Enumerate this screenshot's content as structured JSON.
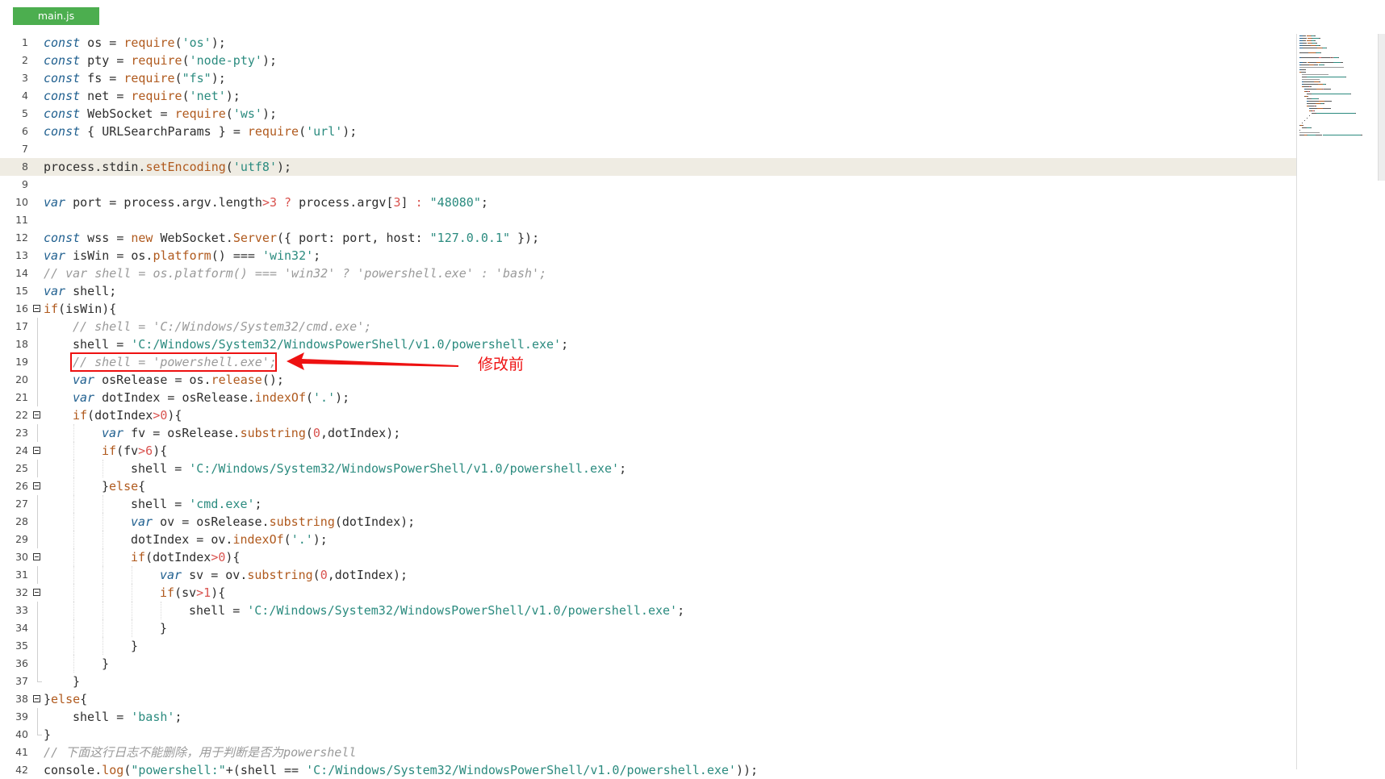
{
  "tab": {
    "label": "main.js"
  },
  "colors": {
    "tab_bg": "#4cae4f",
    "highlight_line": "#efece3",
    "keyword": "#1f5f8f",
    "string": "#2b8b7f",
    "function": "#b05a1e",
    "number": "#d9534f",
    "comment": "#9a9a9a",
    "annotation": "#ee1111"
  },
  "annotation": {
    "label": "修改前",
    "target_line": 19
  },
  "highlighted_line": 8,
  "code": [
    {
      "n": "1",
      "indent": 0,
      "tokens": [
        [
          "k",
          "const"
        ],
        [
          "o",
          " os "
        ],
        [
          "o",
          "="
        ],
        [
          "o",
          " "
        ],
        [
          "f",
          "require"
        ],
        [
          "o",
          "("
        ],
        [
          "s",
          "'os'"
        ],
        [
          "o",
          ");"
        ]
      ]
    },
    {
      "n": "2",
      "indent": 0,
      "tokens": [
        [
          "k",
          "const"
        ],
        [
          "o",
          " pty "
        ],
        [
          "o",
          "="
        ],
        [
          "o",
          " "
        ],
        [
          "f",
          "require"
        ],
        [
          "o",
          "("
        ],
        [
          "s",
          "'node-pty'"
        ],
        [
          "o",
          ");"
        ]
      ]
    },
    {
      "n": "3",
      "indent": 0,
      "tokens": [
        [
          "k",
          "const"
        ],
        [
          "o",
          " fs "
        ],
        [
          "o",
          "="
        ],
        [
          "o",
          " "
        ],
        [
          "f",
          "require"
        ],
        [
          "o",
          "("
        ],
        [
          "s",
          "\"fs\""
        ],
        [
          "o",
          ");"
        ]
      ]
    },
    {
      "n": "4",
      "indent": 0,
      "tokens": [
        [
          "k",
          "const"
        ],
        [
          "o",
          " net "
        ],
        [
          "o",
          "="
        ],
        [
          "o",
          " "
        ],
        [
          "f",
          "require"
        ],
        [
          "o",
          "("
        ],
        [
          "s",
          "'net'"
        ],
        [
          "o",
          ");"
        ]
      ]
    },
    {
      "n": "5",
      "indent": 0,
      "tokens": [
        [
          "k",
          "const"
        ],
        [
          "o",
          " WebSocket "
        ],
        [
          "o",
          "="
        ],
        [
          "o",
          " "
        ],
        [
          "f",
          "require"
        ],
        [
          "o",
          "("
        ],
        [
          "s",
          "'ws'"
        ],
        [
          "o",
          ");"
        ]
      ]
    },
    {
      "n": "6",
      "indent": 0,
      "tokens": [
        [
          "k",
          "const"
        ],
        [
          "o",
          " { URLSearchParams } "
        ],
        [
          "o",
          "="
        ],
        [
          "o",
          " "
        ],
        [
          "f",
          "require"
        ],
        [
          "o",
          "("
        ],
        [
          "s",
          "'url'"
        ],
        [
          "o",
          ");"
        ]
      ]
    },
    {
      "n": "7",
      "indent": 0,
      "tokens": []
    },
    {
      "n": "8",
      "indent": 0,
      "tokens": [
        [
          "o",
          "process.stdin."
        ],
        [
          "f",
          "setEncoding"
        ],
        [
          "o",
          "("
        ],
        [
          "s",
          "'utf8'"
        ],
        [
          "o",
          ");"
        ]
      ]
    },
    {
      "n": "9",
      "indent": 0,
      "tokens": []
    },
    {
      "n": "10",
      "indent": 0,
      "tokens": [
        [
          "k",
          "var"
        ],
        [
          "o",
          " port "
        ],
        [
          "o",
          "="
        ],
        [
          "o",
          " process.argv.length"
        ],
        [
          "n",
          ">3"
        ],
        [
          "o",
          " "
        ],
        [
          "n",
          "?"
        ],
        [
          "o",
          " process.argv["
        ],
        [
          "n",
          "3"
        ],
        [
          "o",
          "] "
        ],
        [
          "n",
          ":"
        ],
        [
          "o",
          " "
        ],
        [
          "s",
          "\"48080\""
        ],
        [
          "o",
          ";"
        ]
      ]
    },
    {
      "n": "11",
      "indent": 0,
      "tokens": []
    },
    {
      "n": "12",
      "indent": 0,
      "tokens": [
        [
          "k",
          "const"
        ],
        [
          "o",
          " wss "
        ],
        [
          "o",
          "="
        ],
        [
          "o",
          " "
        ],
        [
          "f",
          "new"
        ],
        [
          "o",
          " WebSocket."
        ],
        [
          "f",
          "Server"
        ],
        [
          "o",
          "({ port: port, host: "
        ],
        [
          "s",
          "\"127.0.0.1\""
        ],
        [
          "o",
          " });"
        ]
      ]
    },
    {
      "n": "13",
      "indent": 0,
      "tokens": [
        [
          "k",
          "var"
        ],
        [
          "o",
          " isWin "
        ],
        [
          "o",
          "="
        ],
        [
          "o",
          " os."
        ],
        [
          "f",
          "platform"
        ],
        [
          "o",
          "() "
        ],
        [
          "o",
          "==="
        ],
        [
          "o",
          " "
        ],
        [
          "s",
          "'win32'"
        ],
        [
          "o",
          ";"
        ]
      ]
    },
    {
      "n": "14",
      "indent": 0,
      "tokens": [
        [
          "c",
          "// var shell = os.platform() === 'win32' ? 'powershell.exe' : 'bash';"
        ]
      ]
    },
    {
      "n": "15",
      "indent": 0,
      "tokens": [
        [
          "k",
          "var"
        ],
        [
          "o",
          " shell;"
        ]
      ]
    },
    {
      "n": "16",
      "indent": 0,
      "fold": true,
      "tokens": [
        [
          "f",
          "if"
        ],
        [
          "o",
          "(isWin){"
        ]
      ]
    },
    {
      "n": "17",
      "indent": 1,
      "guide": true,
      "tokens": [
        [
          "c",
          "// shell = 'C:/Windows/System32/cmd.exe';"
        ]
      ]
    },
    {
      "n": "18",
      "indent": 1,
      "guide": true,
      "tokens": [
        [
          "o",
          "shell "
        ],
        [
          "o",
          "="
        ],
        [
          "o",
          " "
        ],
        [
          "s",
          "'C:/Windows/System32/WindowsPowerShell/v1.0/powershell.exe'"
        ],
        [
          "o",
          ";"
        ]
      ]
    },
    {
      "n": "19",
      "indent": 1,
      "guide": true,
      "tokens": [
        [
          "c",
          "// shell = 'powershell.exe';"
        ]
      ]
    },
    {
      "n": "20",
      "indent": 1,
      "guide": true,
      "tokens": [
        [
          "k",
          "var"
        ],
        [
          "o",
          " osRelease "
        ],
        [
          "o",
          "="
        ],
        [
          "o",
          " os."
        ],
        [
          "f",
          "release"
        ],
        [
          "o",
          "();"
        ]
      ]
    },
    {
      "n": "21",
      "indent": 1,
      "guide": true,
      "tokens": [
        [
          "k",
          "var"
        ],
        [
          "o",
          " dotIndex "
        ],
        [
          "o",
          "="
        ],
        [
          "o",
          " osRelease."
        ],
        [
          "f",
          "indexOf"
        ],
        [
          "o",
          "("
        ],
        [
          "s",
          "'.'"
        ],
        [
          "o",
          ");"
        ]
      ]
    },
    {
      "n": "22",
      "indent": 1,
      "fold": true,
      "tokens": [
        [
          "f",
          "if"
        ],
        [
          "o",
          "(dotIndex"
        ],
        [
          "n",
          ">0"
        ],
        [
          "o",
          "){"
        ]
      ]
    },
    {
      "n": "23",
      "indent": 2,
      "guide": true,
      "tokens": [
        [
          "k",
          "var"
        ],
        [
          "o",
          " fv "
        ],
        [
          "o",
          "="
        ],
        [
          "o",
          " osRelease."
        ],
        [
          "f",
          "substring"
        ],
        [
          "o",
          "("
        ],
        [
          "n",
          "0"
        ],
        [
          "o",
          ",dotIndex);"
        ]
      ]
    },
    {
      "n": "24",
      "indent": 2,
      "fold": true,
      "tokens": [
        [
          "f",
          "if"
        ],
        [
          "o",
          "(fv"
        ],
        [
          "n",
          ">6"
        ],
        [
          "o",
          "){"
        ]
      ]
    },
    {
      "n": "25",
      "indent": 3,
      "guide": true,
      "tokens": [
        [
          "o",
          "shell "
        ],
        [
          "o",
          "="
        ],
        [
          "o",
          " "
        ],
        [
          "s",
          "'C:/Windows/System32/WindowsPowerShell/v1.0/powershell.exe'"
        ],
        [
          "o",
          ";"
        ]
      ]
    },
    {
      "n": "26",
      "indent": 2,
      "fold": true,
      "tokens": [
        [
          "o",
          "}"
        ],
        [
          "f",
          "else"
        ],
        [
          "o",
          "{"
        ]
      ]
    },
    {
      "n": "27",
      "indent": 3,
      "guide": true,
      "tokens": [
        [
          "o",
          "shell "
        ],
        [
          "o",
          "="
        ],
        [
          "o",
          " "
        ],
        [
          "s",
          "'cmd.exe'"
        ],
        [
          "o",
          ";"
        ]
      ]
    },
    {
      "n": "28",
      "indent": 3,
      "guide": true,
      "tokens": [
        [
          "k",
          "var"
        ],
        [
          "o",
          " ov "
        ],
        [
          "o",
          "="
        ],
        [
          "o",
          " osRelease."
        ],
        [
          "f",
          "substring"
        ],
        [
          "o",
          "(dotIndex);"
        ]
      ]
    },
    {
      "n": "29",
      "indent": 3,
      "guide": true,
      "tokens": [
        [
          "o",
          "dotIndex "
        ],
        [
          "o",
          "="
        ],
        [
          "o",
          " ov."
        ],
        [
          "f",
          "indexOf"
        ],
        [
          "o",
          "("
        ],
        [
          "s",
          "'.'"
        ],
        [
          "o",
          ");"
        ]
      ]
    },
    {
      "n": "30",
      "indent": 3,
      "fold": true,
      "tokens": [
        [
          "f",
          "if"
        ],
        [
          "o",
          "(dotIndex"
        ],
        [
          "n",
          ">0"
        ],
        [
          "o",
          "){"
        ]
      ]
    },
    {
      "n": "31",
      "indent": 4,
      "guide": true,
      "tokens": [
        [
          "k",
          "var"
        ],
        [
          "o",
          " sv "
        ],
        [
          "o",
          "="
        ],
        [
          "o",
          " ov."
        ],
        [
          "f",
          "substring"
        ],
        [
          "o",
          "("
        ],
        [
          "n",
          "0"
        ],
        [
          "o",
          ",dotIndex);"
        ]
      ]
    },
    {
      "n": "32",
      "indent": 4,
      "fold": true,
      "tokens": [
        [
          "f",
          "if"
        ],
        [
          "o",
          "(sv"
        ],
        [
          "n",
          ">1"
        ],
        [
          "o",
          "){"
        ]
      ]
    },
    {
      "n": "33",
      "indent": 5,
      "guide": true,
      "tokens": [
        [
          "o",
          "shell "
        ],
        [
          "o",
          "="
        ],
        [
          "o",
          " "
        ],
        [
          "s",
          "'C:/Windows/System32/WindowsPowerShell/v1.0/powershell.exe'"
        ],
        [
          "o",
          ";"
        ]
      ]
    },
    {
      "n": "34",
      "indent": 4,
      "guide": true,
      "tokens": [
        [
          "o",
          "}"
        ]
      ]
    },
    {
      "n": "35",
      "indent": 3,
      "guide": true,
      "tokens": [
        [
          "o",
          "}"
        ]
      ]
    },
    {
      "n": "36",
      "indent": 2,
      "guide": true,
      "tokens": [
        [
          "o",
          "}"
        ]
      ]
    },
    {
      "n": "37",
      "indent": 1,
      "guideEnd": true,
      "tokens": [
        [
          "o",
          "}"
        ]
      ]
    },
    {
      "n": "38",
      "indent": 0,
      "fold": true,
      "tokens": [
        [
          "o",
          "}"
        ],
        [
          "f",
          "else"
        ],
        [
          "o",
          "{"
        ]
      ]
    },
    {
      "n": "39",
      "indent": 1,
      "guide": true,
      "tokens": [
        [
          "o",
          "shell "
        ],
        [
          "o",
          "="
        ],
        [
          "o",
          " "
        ],
        [
          "s",
          "'bash'"
        ],
        [
          "o",
          ";"
        ]
      ]
    },
    {
      "n": "40",
      "indent": 0,
      "guideEnd": true,
      "tokens": [
        [
          "o",
          "}"
        ]
      ]
    },
    {
      "n": "41",
      "indent": 0,
      "tokens": [
        [
          "c",
          "// 下面这行日志不能删除，用于判断是否为powershell"
        ]
      ]
    },
    {
      "n": "42",
      "indent": 0,
      "tokens": [
        [
          "o",
          "console."
        ],
        [
          "f",
          "log"
        ],
        [
          "o",
          "("
        ],
        [
          "s",
          "\"powershell:\""
        ],
        [
          "o",
          "+(shell "
        ],
        [
          "o",
          "=="
        ],
        [
          "o",
          " "
        ],
        [
          "s",
          "'C:/Windows/System32/WindowsPowerShell/v1.0/powershell.exe'"
        ],
        [
          "o",
          "));"
        ]
      ]
    }
  ]
}
